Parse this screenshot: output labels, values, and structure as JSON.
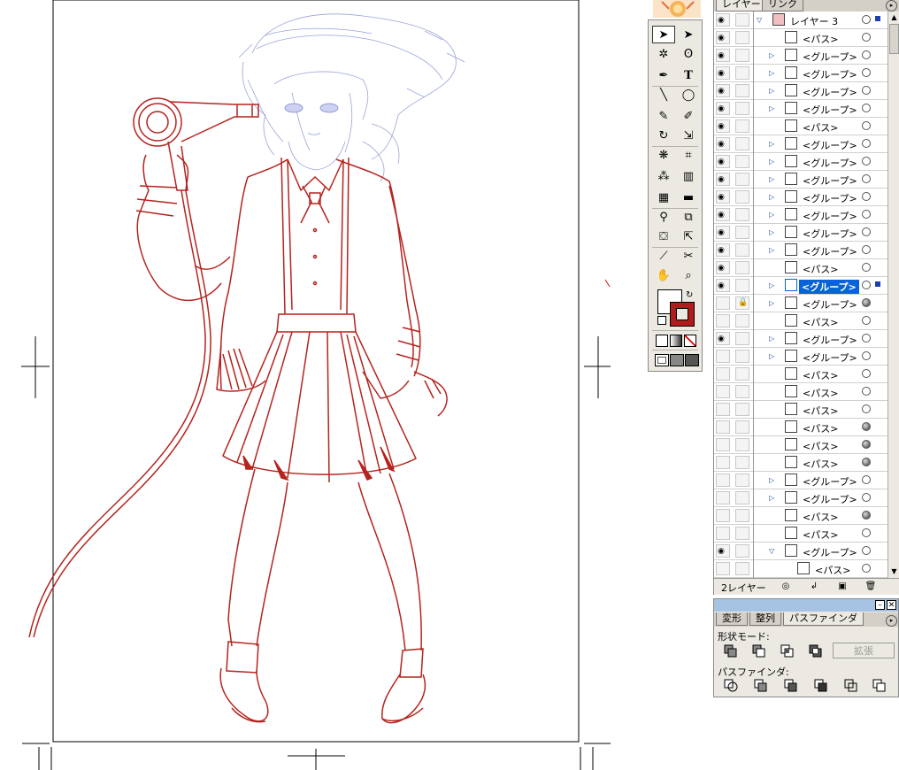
{
  "layers_panel": {
    "tabs": [
      "レイヤー",
      "リンク"
    ],
    "layer_count": "2レイヤー",
    "items": [
      {
        "name": "レイヤー 3",
        "visible": true,
        "lock": false,
        "expander": "open",
        "indent": 0,
        "target": "empty"
      },
      {
        "name": "<パス>",
        "visible": true,
        "lock": false,
        "expander": "none",
        "indent": 1,
        "target": "empty"
      },
      {
        "name": "<グループ>",
        "visible": true,
        "lock": false,
        "expander": "closed",
        "indent": 1,
        "target": "empty"
      },
      {
        "name": "<グループ>",
        "visible": true,
        "lock": false,
        "expander": "closed",
        "indent": 1,
        "target": "empty"
      },
      {
        "name": "<グループ>",
        "visible": true,
        "lock": false,
        "expander": "closed",
        "indent": 1,
        "target": "empty"
      },
      {
        "name": "<グループ>",
        "visible": true,
        "lock": false,
        "expander": "closed",
        "indent": 1,
        "target": "empty"
      },
      {
        "name": "<パス>",
        "visible": true,
        "lock": false,
        "expander": "none",
        "indent": 1,
        "target": "empty"
      },
      {
        "name": "<グループ>",
        "visible": true,
        "lock": false,
        "expander": "closed",
        "indent": 1,
        "target": "empty"
      },
      {
        "name": "<グループ>",
        "visible": true,
        "lock": false,
        "expander": "closed",
        "indent": 1,
        "target": "empty"
      },
      {
        "name": "<グループ>",
        "visible": true,
        "lock": false,
        "expander": "closed",
        "indent": 1,
        "target": "empty"
      },
      {
        "name": "<グループ>",
        "visible": true,
        "lock": false,
        "expander": "closed",
        "indent": 1,
        "target": "empty"
      },
      {
        "name": "<グループ>",
        "visible": true,
        "lock": false,
        "expander": "closed",
        "indent": 1,
        "target": "empty"
      },
      {
        "name": "<グループ>",
        "visible": true,
        "lock": false,
        "expander": "closed",
        "indent": 1,
        "target": "empty"
      },
      {
        "name": "<グループ>",
        "visible": true,
        "lock": false,
        "expander": "closed",
        "indent": 1,
        "target": "empty"
      },
      {
        "name": "<パス>",
        "visible": true,
        "lock": false,
        "expander": "none",
        "indent": 1,
        "target": "empty"
      },
      {
        "name": "<グループ>",
        "visible": true,
        "lock": false,
        "expander": "closed",
        "indent": 1,
        "target": "empty",
        "selected": true
      },
      {
        "name": "<グループ>",
        "visible": false,
        "lock": true,
        "expander": "closed",
        "indent": 1,
        "target": "filled"
      },
      {
        "name": "<パス>",
        "visible": false,
        "lock": false,
        "expander": "none",
        "indent": 1,
        "target": "empty"
      },
      {
        "name": "<グループ>",
        "visible": true,
        "lock": false,
        "expander": "closed",
        "indent": 1,
        "target": "empty"
      },
      {
        "name": "<グループ>",
        "visible": false,
        "lock": false,
        "expander": "closed",
        "indent": 1,
        "target": "empty"
      },
      {
        "name": "<パス>",
        "visible": false,
        "lock": false,
        "expander": "none",
        "indent": 1,
        "target": "empty"
      },
      {
        "name": "<パス>",
        "visible": false,
        "lock": false,
        "expander": "none",
        "indent": 1,
        "target": "empty"
      },
      {
        "name": "<パス>",
        "visible": false,
        "lock": false,
        "expander": "none",
        "indent": 1,
        "target": "empty"
      },
      {
        "name": "<パス>",
        "visible": false,
        "lock": false,
        "expander": "none",
        "indent": 1,
        "target": "filled"
      },
      {
        "name": "<パス>",
        "visible": false,
        "lock": false,
        "expander": "none",
        "indent": 1,
        "target": "filled"
      },
      {
        "name": "<パス>",
        "visible": false,
        "lock": false,
        "expander": "none",
        "indent": 1,
        "target": "filled"
      },
      {
        "name": "<グループ>",
        "visible": false,
        "lock": false,
        "expander": "closed",
        "indent": 1,
        "target": "empty"
      },
      {
        "name": "<グループ>",
        "visible": false,
        "lock": false,
        "expander": "closed",
        "indent": 1,
        "target": "empty"
      },
      {
        "name": "<パス>",
        "visible": false,
        "lock": false,
        "expander": "none",
        "indent": 1,
        "target": "filled"
      },
      {
        "name": "<パス>",
        "visible": false,
        "lock": false,
        "expander": "none",
        "indent": 1,
        "target": "empty"
      },
      {
        "name": "<グループ>",
        "visible": true,
        "lock": false,
        "expander": "open",
        "indent": 1,
        "target": "empty"
      },
      {
        "name": "<パス>",
        "visible": false,
        "lock": false,
        "expander": "none",
        "indent": 2,
        "target": "empty"
      }
    ]
  },
  "pathfinder_panel": {
    "tabs": [
      "変形",
      "整列",
      "パスファインダ"
    ],
    "shape_modes_label": "形状モード:",
    "pathfinders_label": "パスファインダ:",
    "expand_button": "拡張"
  },
  "tools_panel": {
    "tools": [
      "selection-tool",
      "direct-selection-tool",
      "magic-wand-tool",
      "lasso-tool",
      "pen-tool",
      "type-tool",
      "line-tool",
      "ellipse-tool",
      "paintbrush-tool",
      "pencil-tool",
      "rotate-tool",
      "scale-tool",
      "warp-tool",
      "free-transform-tool",
      "symbol-sprayer-tool",
      "column-graph-tool",
      "mesh-tool",
      "gradient-tool",
      "eyedropper-tool",
      "blend-tool",
      "live-paint-bucket-tool",
      "live-paint-selection-tool",
      "slice-tool",
      "scissors-tool",
      "hand-tool",
      "zoom-tool"
    ],
    "stroke_color": "#b01c1c",
    "fill_color": "#ffffff"
  },
  "colors": {
    "line_art": "#b5241f",
    "sketch_blue": "#8f9ad6",
    "selection_blue": "#0a62d9",
    "panel_bg": "#ece9e2",
    "titlebar": "#a7c3e4"
  }
}
